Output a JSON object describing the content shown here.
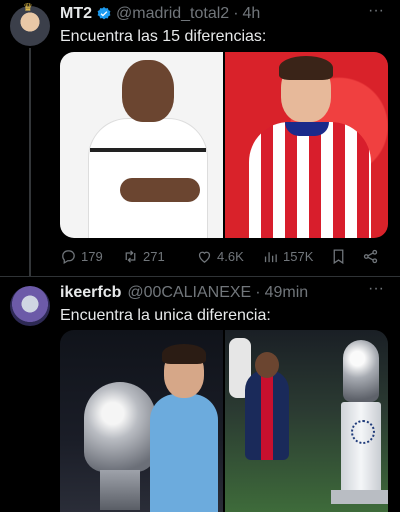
{
  "tweets": [
    {
      "display_name": "MT2",
      "handle": "@madrid_total2",
      "separator": "·",
      "time": "4h",
      "text": "Encuentra las 15 diferencias:",
      "stats": {
        "replies": "179",
        "retweets": "271",
        "likes": "4.6K",
        "views": "157K"
      }
    },
    {
      "display_name": "ikeerfcb",
      "handle": "@00CALIANEXE",
      "separator": "·",
      "time": "49min",
      "text": "Encuentra la unica diferencia:"
    }
  ],
  "more_label": "···",
  "accent_verified": "#1d9bf0",
  "icons": [
    "crown-icon",
    "verified-icon",
    "more-icon",
    "reply-icon",
    "retweet-icon",
    "like-icon",
    "views-icon",
    "bookmark-icon",
    "share-icon"
  ]
}
